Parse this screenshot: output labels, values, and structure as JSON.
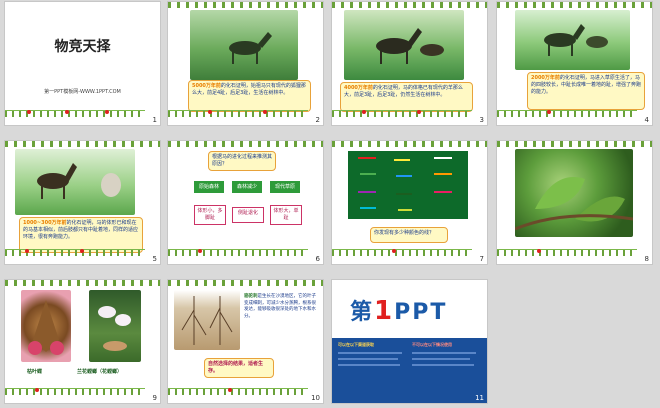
{
  "slides": [
    {
      "num": "1",
      "title": "物竞天择",
      "subtitle": "第一PPT模板网-WWW.1PPT.COM"
    },
    {
      "num": "2",
      "callout_hl": "5000万年前",
      "callout": "的化石证明，始祖马只有现代的狐狸那么大，前足4趾，后足3趾，生活在树林中。"
    },
    {
      "num": "3",
      "callout_hl": "4000万年前",
      "callout": "的化石证明，马的体格已有现代的羊那么大，前足3趾，后足3趾，仍然生活在树林中。"
    },
    {
      "num": "4",
      "callout_hl": "2000万年前",
      "callout": "的化石证明，马进入草原生活了，马的四肢较长，中趾长成唯一着地的趾，增强了奔跑的能力。"
    },
    {
      "num": "5",
      "callout_hl": "1000~300万年前",
      "callout": "的化石证明，马的体形已和现在的马基本相似，前后肢都只有中趾着地，同样的适应环境，很有奔跑能力。"
    },
    {
      "num": "6",
      "question": "根据马的进化过程来推测其原因？",
      "flow": [
        "原始森林",
        "森林减少",
        "现代草原"
      ],
      "outcomes": [
        "体形小，多脚趾",
        "侧趾退化",
        "体形大，单趾"
      ]
    },
    {
      "num": "7",
      "question": "你发现有多少种颜色的线？"
    },
    {
      "num": "8"
    },
    {
      "num": "9",
      "label_left": "枯叶蝶",
      "label_right": "兰花螳螂（花螳螂）"
    },
    {
      "num": "10",
      "text_hl": "骆驼刺",
      "text": "是生长在沙漠地区，它的叶子变成细刺，可减少水分蒸腾，根系很发达，能够吸收很深处的地下水和水分。",
      "result": "自然选择的结果，适者生存。"
    },
    {
      "num": "11",
      "logo_pre": "第",
      "logo_num": "1",
      "logo_post": "PPT",
      "panel_left_title": "可以在以下渠道获取",
      "panel_right_title": "不可以在以下情况使用"
    }
  ],
  "colors": {
    "accent_green": "#2e9b3a",
    "accent_orange": "#e87f00",
    "brand_blue": "#1b5aa8",
    "dot_red": "#e02020"
  }
}
